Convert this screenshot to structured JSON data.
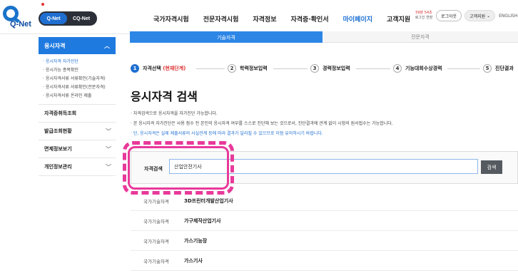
{
  "header": {
    "logo_text": "Q-Net",
    "toggle": {
      "active": "Q-Net",
      "inactive": "CQ-Net"
    },
    "nav": [
      "국가자격시험",
      "전문자격시험",
      "자격정보",
      "자격증·확인서",
      "마이페이지",
      "고객지원"
    ],
    "active_nav": "마이페이지",
    "session_line1": "59분 54초",
    "session_line2": "로그인 연장",
    "logout": "로그아웃",
    "support": "고객지원",
    "lang": "ENGLISH"
  },
  "tabs": {
    "active": "기술자격",
    "inactive": "전문자격"
  },
  "sidebar": {
    "head": "응시자격",
    "sub_items": [
      "응시자격 자가진단",
      "응시가능 종목확인",
      "응시자격서류 서류확인(기술자격)",
      "응시자격서류 서류확인(전문자격)",
      "응시자격서류 온라인 제출"
    ],
    "rows": [
      "자격증취득조회",
      "발급조회현황",
      "면제정보보기",
      "개인정보관리"
    ]
  },
  "stepper": [
    {
      "num": "1",
      "label": "자격선택",
      "current": "(현재단계)"
    },
    {
      "num": "2",
      "label": "학력정보입력"
    },
    {
      "num": "3",
      "label": "경력정보입력"
    },
    {
      "num": "4",
      "label": "기능대회수상경력"
    },
    {
      "num": "5",
      "label": "진단결과"
    }
  ],
  "main": {
    "title": "응시자격 검색",
    "desc": [
      "· 자격검색으로 응시자격을 자가진단 가능합니다.",
      "· 본 응시자격 자가진단은 사용 점수 전 본인의 응시자격 여부를 스스로 진단해 보는 것으로서, 진단결과에 관계 없이 시험의 원서접수는 가능합니다.",
      "· 단, 응시자격은 실제 제출서류의 사실관계 등에 따라 결과가 달라질 수 있으므로 이점 유의하시기 바랍니다."
    ],
    "search_label": "자격검색",
    "search_value": "산업안전기사",
    "search_button": "검색"
  },
  "results": [
    {
      "type": "국가기술자격",
      "name": "3D프린터개발산업기사"
    },
    {
      "type": "국가기술자격",
      "name": "가구제작산업기사"
    },
    {
      "type": "국가기술자격",
      "name": "가스기능장"
    },
    {
      "type": "국가기술자격",
      "name": "가스기사"
    }
  ],
  "colors": {
    "brand": "#1f6fd1",
    "highlight": "#e8399a"
  }
}
